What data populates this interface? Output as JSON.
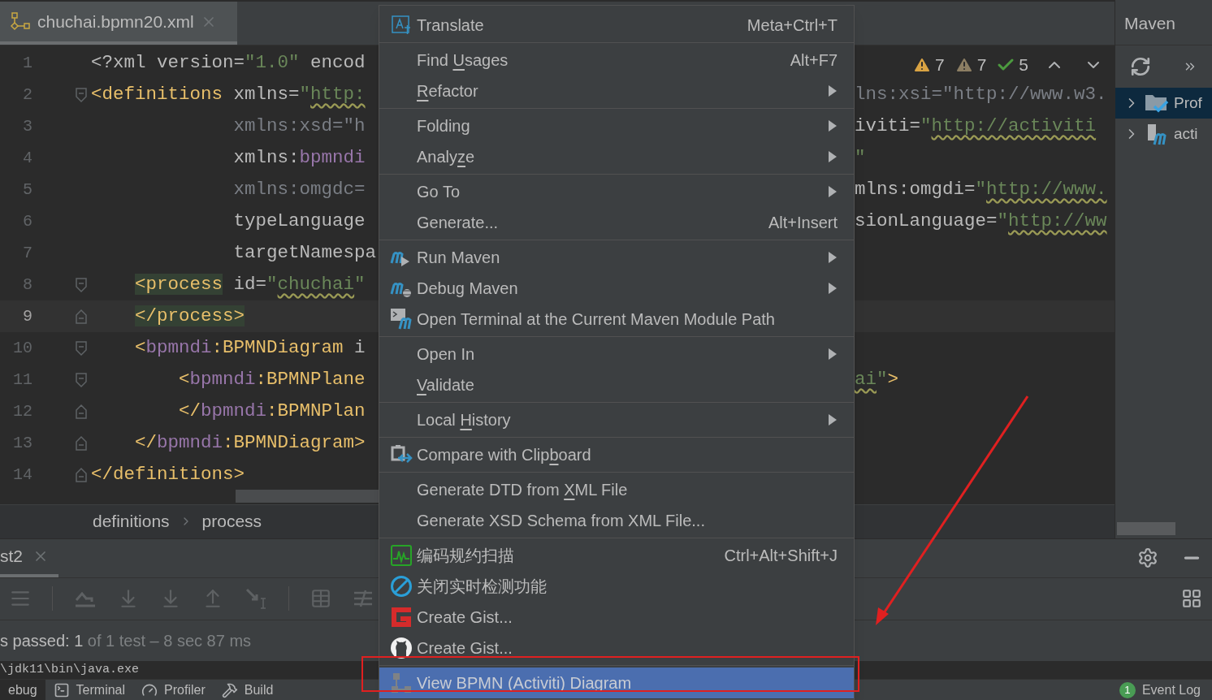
{
  "editor": {
    "tab": {
      "label": "chuchai.bpmn20.xml",
      "selected": true
    },
    "inspections": [
      {
        "kind": "warning",
        "count": "7"
      },
      {
        "kind": "weak_warning",
        "count": "7"
      },
      {
        "kind": "typo",
        "count": "5"
      }
    ],
    "lines": [
      {
        "number": "1",
        "current": false,
        "left": [
          {
            "text": "<?xml version=",
            "kind": "plain"
          },
          {
            "text": "\"1.0\"",
            "kind": "value"
          },
          {
            "text": " encod",
            "kind": "plain"
          }
        ]
      },
      {
        "number": "2",
        "current": false,
        "fold": {
          "kind": "open"
        },
        "left": [
          {
            "text": "<definitions",
            "kind": "tag"
          },
          {
            "text": " xmlns=",
            "kind": "plain"
          },
          {
            "text": "\"",
            "kind": "value"
          },
          {
            "text": "http:",
            "kind": "value",
            "typo": true
          }
        ],
        "right": [
          {
            "text": "lns:xsi=\"http://www.w3.",
            "kind": "dim"
          }
        ]
      },
      {
        "number": "3",
        "current": false,
        "left": [
          {
            "text": "             xmlns:xsd=\"h",
            "kind": "dim"
          }
        ],
        "right": [
          {
            "text": "iviti=",
            "kind": "plain"
          },
          {
            "text": "\"",
            "kind": "value"
          },
          {
            "text": "http://activiti",
            "kind": "value",
            "typo": true
          }
        ]
      },
      {
        "number": "4",
        "current": false,
        "left": [
          {
            "text": "             xmlns:",
            "kind": "plain"
          },
          {
            "text": "bpmndi",
            "kind": "ns"
          }
        ],
        "right": [
          {
            "text": "\"",
            "kind": "value"
          }
        ]
      },
      {
        "number": "5",
        "current": false,
        "left": [
          {
            "text": "             xmlns:omgdc=",
            "kind": "dim"
          }
        ],
        "right": [
          {
            "text": "mlns:omgdi=",
            "kind": "plain"
          },
          {
            "text": "\"",
            "kind": "value"
          },
          {
            "text": "http://www.",
            "kind": "value",
            "typo": true
          }
        ]
      },
      {
        "number": "6",
        "current": false,
        "left": [
          {
            "text": "             typeLanguage",
            "kind": "plain"
          }
        ],
        "right": [
          {
            "text": "sionLanguage=",
            "kind": "plain"
          },
          {
            "text": "\"",
            "kind": "value"
          },
          {
            "text": "http://ww",
            "kind": "value",
            "typo": true
          }
        ]
      },
      {
        "number": "7",
        "current": false,
        "left": [
          {
            "text": "             targetNamespa",
            "kind": "plain"
          }
        ]
      },
      {
        "number": "8",
        "current": false,
        "fold": {
          "kind": "open"
        },
        "left": [
          {
            "text": "    <process",
            "kind": "tag",
            "highlighted": true
          },
          {
            "text": " id=",
            "kind": "plain"
          },
          {
            "text": "\"",
            "kind": "value"
          },
          {
            "text": "chuchai",
            "kind": "value",
            "typo": true
          },
          {
            "text": "\"",
            "kind": "value"
          }
        ]
      },
      {
        "number": "9",
        "current": true,
        "fold": {
          "kind": "close"
        },
        "left": [
          {
            "text": "    </process>",
            "kind": "tag",
            "highlighted": true
          }
        ]
      },
      {
        "number": "10",
        "current": false,
        "fold": {
          "kind": "open"
        },
        "left": [
          {
            "text": "    <",
            "kind": "tag"
          },
          {
            "text": "bpmndi",
            "kind": "ns"
          },
          {
            "text": ":BPMNDiagram",
            "kind": "tag"
          },
          {
            "text": " i",
            "kind": "plain"
          }
        ]
      },
      {
        "number": "11",
        "current": false,
        "fold": {
          "kind": "open"
        },
        "left": [
          {
            "text": "        <",
            "kind": "tag"
          },
          {
            "text": "bpmndi",
            "kind": "ns"
          },
          {
            "text": ":BPMNPlane",
            "kind": "tag"
          }
        ],
        "right": [
          {
            "text": "ai",
            "kind": "value",
            "typo": true
          },
          {
            "text": "\"",
            "kind": "value"
          },
          {
            "text": ">",
            "kind": "tag"
          }
        ]
      },
      {
        "number": "12",
        "current": false,
        "fold": {
          "kind": "close"
        },
        "left": [
          {
            "text": "        </",
            "kind": "tag"
          },
          {
            "text": "bpmndi",
            "kind": "ns"
          },
          {
            "text": ":BPMNPlan",
            "kind": "tag"
          }
        ]
      },
      {
        "number": "13",
        "current": false,
        "fold": {
          "kind": "close"
        },
        "left": [
          {
            "text": "    </",
            "kind": "tag"
          },
          {
            "text": "bpmndi",
            "kind": "ns"
          },
          {
            "text": ":BPMNDiagram>",
            "kind": "tag"
          }
        ]
      },
      {
        "number": "14",
        "current": false,
        "fold": {
          "kind": "close"
        },
        "left": [
          {
            "text": "</definitions>",
            "kind": "tag"
          }
        ]
      }
    ],
    "breadcrumbs": [
      "definitions",
      "process"
    ]
  },
  "maven": {
    "title": "Maven",
    "tree": [
      {
        "kind": "profiles",
        "label": "Prof",
        "selected": true,
        "expanded": false
      },
      {
        "kind": "module",
        "label": "acti",
        "selected": false,
        "expanded": false
      }
    ]
  },
  "menu": {
    "groups": [
      {
        "items": [
          {
            "label": "Translate",
            "shortcut": "Meta+Ctrl+T",
            "submenu": false,
            "selected": false
          }
        ]
      },
      {
        "items": [
          {
            "label_before": "Find ",
            "mnemonic": "U",
            "label_after": "sages",
            "shortcut": "Alt+F7",
            "submenu": false,
            "selected": false
          },
          {
            "mnemonic": "R",
            "label_after": "efactor",
            "submenu": true,
            "selected": false
          }
        ]
      },
      {
        "items": [
          {
            "label": "Folding",
            "submenu": true,
            "selected": false
          },
          {
            "label_before": "Analy",
            "mnemonic": "z",
            "label_after": "e",
            "submenu": true,
            "selected": false
          }
        ]
      },
      {
        "items": [
          {
            "label": "Go To",
            "submenu": true,
            "selected": false
          },
          {
            "label": "Generate...",
            "shortcut": "Alt+Insert",
            "submenu": false,
            "selected": false
          }
        ]
      },
      {
        "items": [
          {
            "label": "Run Maven",
            "submenu": true,
            "selected": false
          },
          {
            "label": "Debug Maven",
            "submenu": true,
            "selected": false
          },
          {
            "label": "Open Terminal at the Current Maven Module Path",
            "submenu": false,
            "selected": false
          }
        ]
      },
      {
        "items": [
          {
            "label": "Open In",
            "submenu": true,
            "selected": false
          },
          {
            "mnemonic": "V",
            "label_after": "alidate",
            "submenu": false,
            "selected": false
          }
        ]
      },
      {
        "items": [
          {
            "label_before": "Local ",
            "mnemonic": "H",
            "label_after": "istory",
            "submenu": true,
            "selected": false
          }
        ]
      },
      {
        "items": [
          {
            "label_before": "Compare with Clip",
            "mnemonic": "b",
            "label_after": "oard",
            "submenu": false,
            "selected": false
          }
        ]
      },
      {
        "items": [
          {
            "label_before": "Generate DTD from ",
            "mnemonic": "X",
            "label_after": "ML File",
            "submenu": false,
            "selected": false
          },
          {
            "label": "Generate XSD Schema from XML File...",
            "submenu": false,
            "selected": false
          }
        ]
      },
      {
        "items": [
          {
            "label": "编码规约扫描",
            "shortcut": "Ctrl+Alt+Shift+J",
            "submenu": false,
            "selected": false
          },
          {
            "label": "关闭实时检测功能",
            "submenu": false,
            "selected": false
          },
          {
            "label": "Create Gist...",
            "submenu": false,
            "selected": false
          },
          {
            "label": "Create Gist...",
            "submenu": false,
            "selected": false
          }
        ]
      },
      {
        "items": [
          {
            "label": "View BPMN (Activiti) Diagram",
            "submenu": false,
            "selected": true
          }
        ]
      }
    ]
  },
  "run_panel": {
    "tabs": [
      {
        "label": "st2",
        "selected": true
      }
    ],
    "status": {
      "main": "s passed: 1",
      "detail": "of 1 test – 8 sec 87 ms"
    },
    "console": "\\jdk11\\bin\\java.exe"
  },
  "tool_stripe": {
    "items": [
      {
        "label": "ebug",
        "selected": true
      },
      {
        "label": "Terminal",
        "selected": false
      },
      {
        "label": "Profiler",
        "selected": false
      },
      {
        "label": "Build",
        "selected": false
      }
    ],
    "event_log": {
      "label": "Event Log",
      "badge": "1"
    }
  }
}
